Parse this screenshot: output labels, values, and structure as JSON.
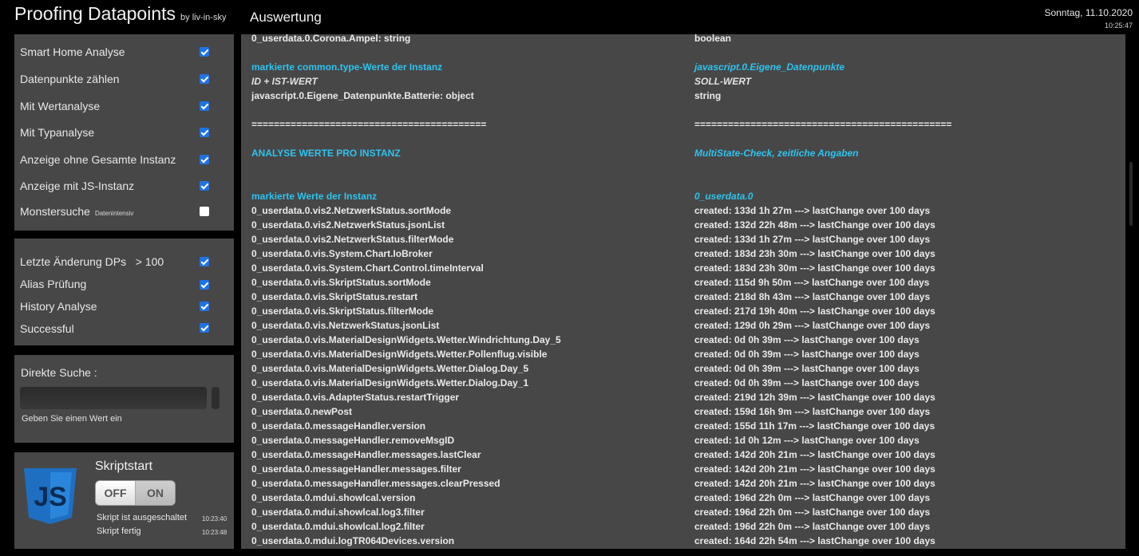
{
  "header": {
    "app_title": "Proofing Datapoints",
    "by_line": "by liv-in-sky",
    "section_title": "Auswertung",
    "date": "Sonntag, 11.10.2020",
    "time": "10:25:47"
  },
  "options": {
    "group1": [
      {
        "label": "Smart Home Analyse",
        "checked": true
      },
      {
        "label": "Datenpunkte zählen",
        "checked": true
      },
      {
        "label": "Mit Wertanalyse",
        "checked": true
      },
      {
        "label": "Mit Typanalyse",
        "checked": true
      },
      {
        "label": "Anzeige ohne Gesamte Instanz",
        "checked": true
      },
      {
        "label": "Anzeige mit JS-Instanz",
        "checked": true
      },
      {
        "label": "Monstersuche",
        "small": "Datenintensiv",
        "checked": false
      }
    ],
    "group2": [
      {
        "label": "Letzte Änderung DPs",
        "suffix": ">  100",
        "checked": true
      },
      {
        "label": "Alias Prüfung",
        "checked": true
      },
      {
        "label": "History Analyse",
        "checked": true
      },
      {
        "label": "Successful",
        "checked": true
      }
    ]
  },
  "search": {
    "label": "Direkte Suche :",
    "value": "",
    "hint": "Geben Sie einen Wert ein"
  },
  "script": {
    "title": "Skriptstart",
    "logo_text": "JS",
    "toggle_off": "OFF",
    "toggle_on": "ON",
    "status": [
      {
        "text": "Skript ist ausgeschaltet",
        "time": "10:23:40"
      },
      {
        "text": "Skript fertig",
        "time": "10:23:48"
      }
    ]
  },
  "colors": {
    "accent": "#2ec3ee",
    "panel": "#474747",
    "checkbox": "#1f73e6",
    "js_logo": "#1e6fc2"
  },
  "rows": [
    {
      "c1": "0_userdata.0.Corona.Ampel: string",
      "c2": "boolean",
      "type": "normal"
    },
    {
      "c1": "",
      "c2": "",
      "type": "blank"
    },
    {
      "c1": "markierte common.type-Werte der Instanz",
      "c2": "javascript.0.Eigene_Datenpunkte",
      "type": "hdr"
    },
    {
      "c1": "ID + IST-WERT",
      "c2": "SOLL-WERT",
      "type": "sub"
    },
    {
      "c1": "javascript.0.Eigene_Datenpunkte.Batterie: object",
      "c2": "string",
      "type": "normal"
    },
    {
      "c1": "",
      "c2": "",
      "type": "blank"
    },
    {
      "c1": "==========================================",
      "c2": "==============================================",
      "type": "normal"
    },
    {
      "c1": "",
      "c2": "",
      "type": "blank"
    },
    {
      "c1": "ANALYSE WERTE PRO INSTANZ",
      "c2": "MultiState-Check, zeitliche Angaben",
      "type": "hdr"
    },
    {
      "c1": "",
      "c2": "",
      "type": "blank"
    },
    {
      "c1": "",
      "c2": "",
      "type": "blank"
    },
    {
      "c1": "markierte Werte der Instanz",
      "c2": "0_userdata.0",
      "type": "hdr"
    },
    {
      "c1": "0_userdata.0.vis2.NetzwerkStatus.sortMode",
      "c2": "created: 133d 1h 27m ---> lastChange over 100 days",
      "type": "normal"
    },
    {
      "c1": "0_userdata.0.vis2.NetzwerkStatus.jsonList",
      "c2": "created: 132d 22h 48m ---> lastChange over 100 days",
      "type": "normal"
    },
    {
      "c1": "0_userdata.0.vis2.NetzwerkStatus.filterMode",
      "c2": "created: 133d 1h 27m ---> lastChange over 100 days",
      "type": "normal"
    },
    {
      "c1": "0_userdata.0.vis.System.Chart.IoBroker",
      "c2": "created: 183d 23h 30m ---> lastChange over 100 days",
      "type": "normal"
    },
    {
      "c1": "0_userdata.0.vis.System.Chart.Control.timeInterval",
      "c2": "created: 183d 23h 30m ---> lastChange over 100 days",
      "type": "normal"
    },
    {
      "c1": "0_userdata.0.vis.SkriptStatus.sortMode",
      "c2": "created: 115d 9h 50m ---> lastChange over 100 days",
      "type": "normal"
    },
    {
      "c1": "0_userdata.0.vis.SkriptStatus.restart",
      "c2": "created: 218d 8h 43m ---> lastChange over 100 days",
      "type": "normal"
    },
    {
      "c1": "0_userdata.0.vis.SkriptStatus.filterMode",
      "c2": "created: 217d 19h 40m ---> lastChange over 100 days",
      "type": "normal"
    },
    {
      "c1": "0_userdata.0.vis.NetzwerkStatus.jsonList",
      "c2": "created: 129d 0h 29m ---> lastChange over 100 days",
      "type": "normal"
    },
    {
      "c1": "0_userdata.0.vis.MaterialDesignWidgets.Wetter.Windrichtung.Day_5",
      "c2": "created: 0d 0h 39m ---> lastChange over 100 days",
      "type": "normal"
    },
    {
      "c1": "0_userdata.0.vis.MaterialDesignWidgets.Wetter.Pollenflug.visible",
      "c2": "created: 0d 0h 39m ---> lastChange over 100 days",
      "type": "normal"
    },
    {
      "c1": "0_userdata.0.vis.MaterialDesignWidgets.Wetter.Dialog.Day_5",
      "c2": "created: 0d 0h 39m ---> lastChange over 100 days",
      "type": "normal"
    },
    {
      "c1": "0_userdata.0.vis.MaterialDesignWidgets.Wetter.Dialog.Day_1",
      "c2": "created: 0d 0h 39m ---> lastChange over 100 days",
      "type": "normal"
    },
    {
      "c1": "0_userdata.0.vis.AdapterStatus.restartTrigger",
      "c2": "created: 219d 12h 39m ---> lastChange over 100 days",
      "type": "normal"
    },
    {
      "c1": "0_userdata.0.newPost",
      "c2": "created: 159d 16h 9m ---> lastChange over 100 days",
      "type": "normal"
    },
    {
      "c1": "0_userdata.0.messageHandler.version",
      "c2": "created: 155d 11h 17m ---> lastChange over 100 days",
      "type": "normal"
    },
    {
      "c1": "0_userdata.0.messageHandler.removeMsgID",
      "c2": "created: 1d 0h 12m ---> lastChange over 100 days",
      "type": "normal"
    },
    {
      "c1": "0_userdata.0.messageHandler.messages.lastClear",
      "c2": "created: 142d 20h 21m ---> lastChange over 100 days",
      "type": "normal"
    },
    {
      "c1": "0_userdata.0.messageHandler.messages.filter",
      "c2": "created: 142d 20h 21m ---> lastChange over 100 days",
      "type": "normal"
    },
    {
      "c1": "0_userdata.0.messageHandler.messages.clearPressed",
      "c2": "created: 142d 20h 21m ---> lastChange over 100 days",
      "type": "normal"
    },
    {
      "c1": "0_userdata.0.mdui.showlcal.version",
      "c2": "created: 196d 22h 0m ---> lastChange over 100 days",
      "type": "normal"
    },
    {
      "c1": "0_userdata.0.mdui.showlcal.log3.filter",
      "c2": "created: 196d 22h 0m ---> lastChange over 100 days",
      "type": "normal"
    },
    {
      "c1": "0_userdata.0.mdui.showlcal.log2.filter",
      "c2": "created: 196d 22h 0m ---> lastChange over 100 days",
      "type": "normal"
    },
    {
      "c1": "0_userdata.0.mdui.logTR064Devices.version",
      "c2": "created: 164d 22h 54m ---> lastChange over 100 days",
      "type": "normal"
    }
  ]
}
